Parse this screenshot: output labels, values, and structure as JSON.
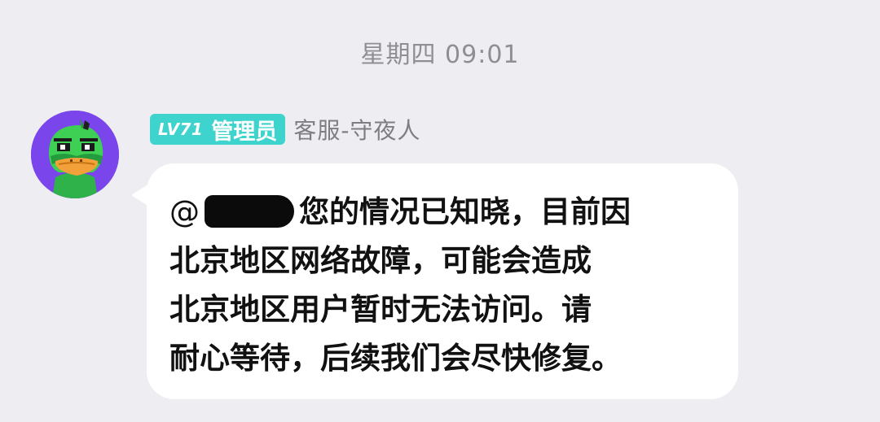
{
  "timestamp": "星期四 09:01",
  "sender": {
    "level": "LV71",
    "role": "管理员",
    "name": "客服-守夜人"
  },
  "message": {
    "mention_prefix": "@",
    "lines": [
      "您的情况已知晓，目前因",
      "北京地区网络故障，可能会造成",
      "北京地区用户暂时无法访问。请",
      "耐心等待，后续我们会尽快修复。"
    ]
  },
  "colors": {
    "background": "#ededf2",
    "badge": "#3fd3cd",
    "avatar_bg": "#7a45ea",
    "bubble": "#ffffff"
  },
  "icons": {
    "avatar": "green-duck-avatar-icon"
  }
}
